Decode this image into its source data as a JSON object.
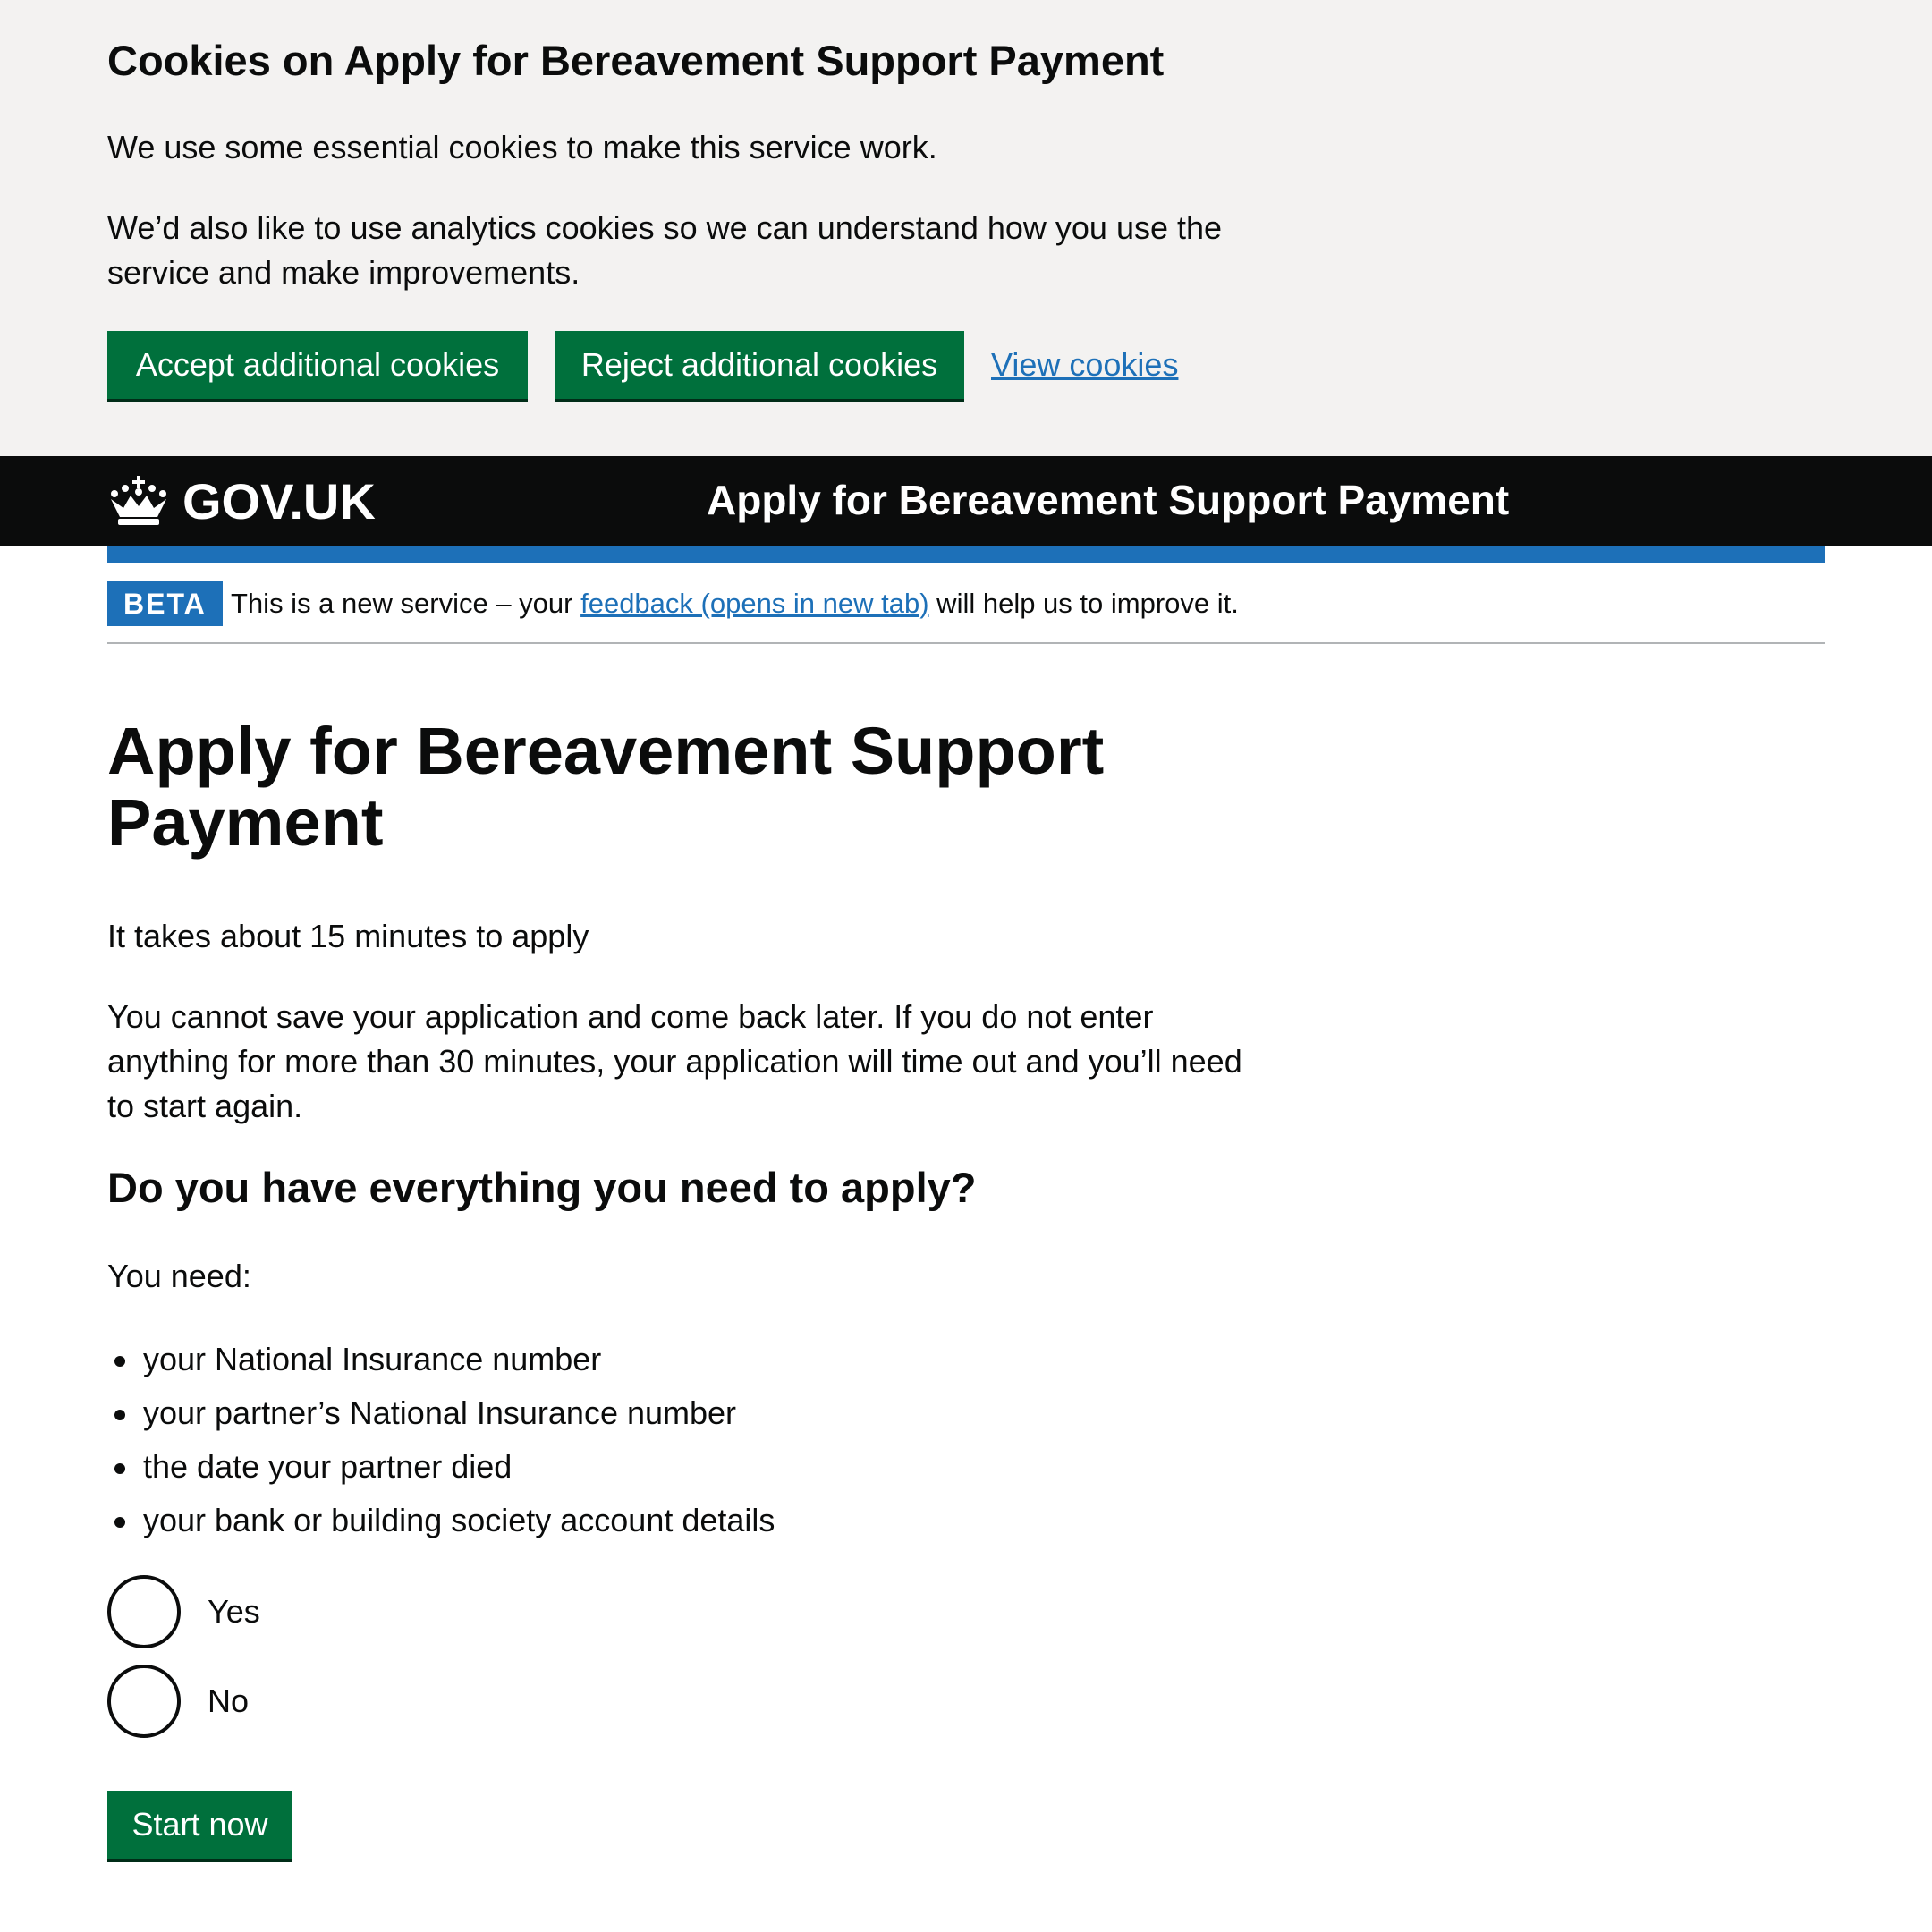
{
  "cookie_banner": {
    "title": "Cookies on Apply for Bereavement Support Payment",
    "paragraph_1": "We use some essential cookies to make this service work.",
    "paragraph_2": "We’d also like to use analytics cookies so we can understand how you use the service and make improvements.",
    "accept_label": "Accept additional cookies",
    "reject_label": "Reject additional cookies",
    "view_label": "View cookies"
  },
  "header": {
    "logo_text": "GOV.UK",
    "service_name": "Apply for Bereavement Support Payment",
    "logo_icon": "crown-icon"
  },
  "phase_banner": {
    "tag": "BETA",
    "text_before": "This is a new service – your ",
    "link_text": "feedback (opens in new tab)",
    "text_after": " will help us to improve it."
  },
  "main": {
    "title": "Apply for Bereavement Support Payment",
    "time_text": "It takes about 15 minutes to apply",
    "save_text": "You cannot save your application and come back later. If you do not enter anything for more than 30 minutes, your application will time out and you’ll need to start again.",
    "subheading": "Do you have everything you need to apply?",
    "need_label": "You need:",
    "needs": [
      "your National Insurance number",
      "your partner’s National Insurance number",
      "the date your partner died",
      "your bank or building society account details"
    ],
    "radio_yes": "Yes",
    "radio_no": "No",
    "start_label": "Start now"
  },
  "colors": {
    "button_green": "#00703c",
    "link_blue": "#1d70b8",
    "header_black": "#0b0c0c",
    "banner_grey": "#f3f2f1"
  }
}
